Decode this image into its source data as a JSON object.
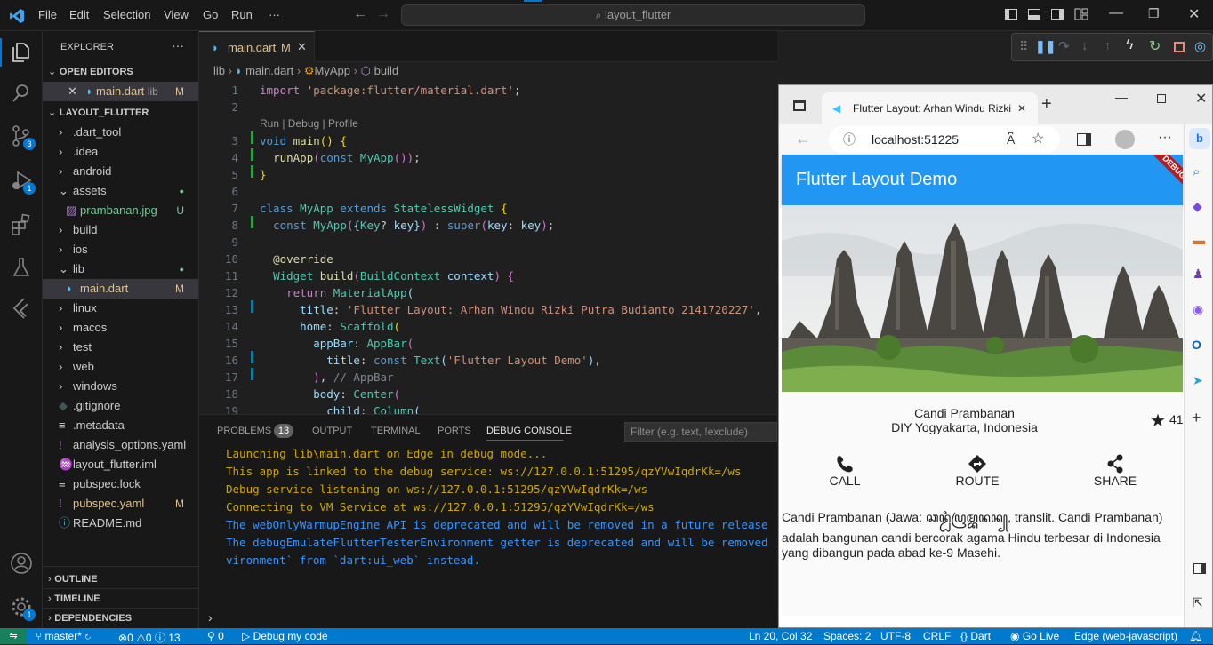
{
  "menu": [
    "File",
    "Edit",
    "Selection",
    "View",
    "Go",
    "Run",
    "···"
  ],
  "search": {
    "text": "layout_flutter"
  },
  "activity": {
    "scm_badge": "3",
    "debug_badge": "1",
    "settings_badge": "1"
  },
  "sidebar": {
    "title": "EXPLORER",
    "open_editors": "OPEN EDITORS",
    "open_file": {
      "name": "main.dart",
      "folder": "lib",
      "status": "M"
    },
    "project": "LAYOUT_FLUTTER",
    "tree": [
      {
        "name": ".dart_tool",
        "kind": "folder",
        "status": ""
      },
      {
        "name": ".idea",
        "kind": "folder",
        "status": ""
      },
      {
        "name": "android",
        "kind": "folder",
        "status": ""
      },
      {
        "name": "assets",
        "kind": "folder-open",
        "status": "●"
      },
      {
        "name": "prambanan.jpg",
        "kind": "image",
        "status": "U"
      },
      {
        "name": "build",
        "kind": "folder",
        "status": ""
      },
      {
        "name": "ios",
        "kind": "folder",
        "status": ""
      },
      {
        "name": "lib",
        "kind": "folder-open",
        "status": "●"
      },
      {
        "name": "main.dart",
        "kind": "dart",
        "status": "M"
      },
      {
        "name": "linux",
        "kind": "folder",
        "status": ""
      },
      {
        "name": "macos",
        "kind": "folder",
        "status": ""
      },
      {
        "name": "test",
        "kind": "folder",
        "status": ""
      },
      {
        "name": "web",
        "kind": "folder",
        "status": ""
      },
      {
        "name": "windows",
        "kind": "folder",
        "status": ""
      },
      {
        "name": ".gitignore",
        "kind": "git",
        "status": ""
      },
      {
        "name": ".metadata",
        "kind": "lines",
        "status": ""
      },
      {
        "name": "analysis_options.yaml",
        "kind": "yaml",
        "status": ""
      },
      {
        "name": "layout_flutter.iml",
        "kind": "rss",
        "status": ""
      },
      {
        "name": "pubspec.lock",
        "kind": "lines",
        "status": ""
      },
      {
        "name": "pubspec.yaml",
        "kind": "yaml",
        "status": "M"
      },
      {
        "name": "README.md",
        "kind": "info",
        "status": ""
      }
    ],
    "outline": "OUTLINE",
    "timeline": "TIMELINE",
    "dependencies": "DEPENDENCIES"
  },
  "editor": {
    "tab": {
      "name": "main.dart",
      "status": "M"
    },
    "breadcrumb": [
      "lib",
      "main.dart",
      "MyApp",
      "build"
    ],
    "codelens": "Run | Debug | Profile",
    "line_numbers": [
      "1",
      "2",
      "",
      "3",
      "4",
      "5",
      "6",
      "7",
      "8",
      "9",
      "10",
      "11",
      "12",
      "13",
      "14",
      "15",
      "16",
      "17",
      "18",
      "19"
    ]
  },
  "panel": {
    "tabs": [
      "PROBLEMS",
      "OUTPUT",
      "TERMINAL",
      "PORTS",
      "DEBUG CONSOLE"
    ],
    "problems_count": "13",
    "filter_placeholder": "Filter (e.g. text, !exclude)",
    "console": [
      "Launching lib\\main.dart on Edge in debug mode...",
      "This app is linked to the debug service: ws://127.0.0.1:51295/qzYVwIqdrKk=/ws",
      "Debug service listening on ws://127.0.0.1:51295/qzYVwIqdrKk=/ws",
      "Connecting to VM Service at ws://127.0.0.1:51295/qzYVwIqdrKk=/ws",
      "The webOnlyWarmupEngine API is deprecated and will be removed in a future release",
      "The debugEmulateFlutterTesterEnvironment getter is deprecated and will be removed",
      "vironment` from `dart:ui_web` instead."
    ],
    "console_colors": [
      "#cca700",
      "#cca700",
      "#cca700",
      "#cca700",
      "#3794ff",
      "#3794ff",
      "#3794ff"
    ]
  },
  "status": {
    "branch": "master*",
    "errors": "0",
    "warnings": "0",
    "infos": "13",
    "ports": "0",
    "debug": "Debug my code",
    "position": "Ln 20, Col 32",
    "spaces": "Spaces: 2",
    "encoding": "UTF-8",
    "eol": "CRLF",
    "language": "Dart",
    "golive": "Go Live",
    "device": "Edge (web-javascript)"
  },
  "browser": {
    "tab_title": "Flutter Layout: Arhan Windu Rizki",
    "url": "localhost:51225",
    "app": {
      "title": "Flutter Layout Demo",
      "debug_banner": "DEBUG",
      "place": "Candi Prambanan",
      "location": "DIY Yogyakarta, Indonesia",
      "rating": "41",
      "buttons": [
        "CALL",
        "ROUTE",
        "SHARE"
      ],
      "desc1": "Candi Prambanan (Jawa: ꦕꦤ꧀ꦝꦶꦥꦿꦩ꧀ꦧꦤꦤ꧀, translit. Candi Prambanan)",
      "desc2": "adalah bangunan candi bercorak agama Hindu terbesar di Indonesia yang dibangun pada abad ke-9 Masehi."
    }
  }
}
